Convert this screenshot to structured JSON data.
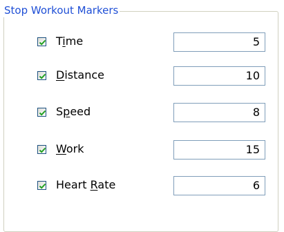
{
  "group": {
    "title": "Stop Workout Markers"
  },
  "markers": [
    {
      "label_pre": "T",
      "label_key": "i",
      "label_post": "me",
      "checked": true,
      "value": "5"
    },
    {
      "label_pre": "",
      "label_key": "D",
      "label_post": "istance",
      "checked": true,
      "value": "10"
    },
    {
      "label_pre": "S",
      "label_key": "p",
      "label_post": "eed",
      "checked": true,
      "value": "8"
    },
    {
      "label_pre": "",
      "label_key": "W",
      "label_post": "ork",
      "checked": true,
      "value": "15"
    },
    {
      "label_pre": "Heart ",
      "label_key": "R",
      "label_post": "ate",
      "checked": true,
      "value": "6"
    }
  ],
  "colors": {
    "title": "#1f4fd6",
    "checkmark": "#21a121",
    "checkbox_border": "#1c5180",
    "field_border": "#7f9db9"
  }
}
